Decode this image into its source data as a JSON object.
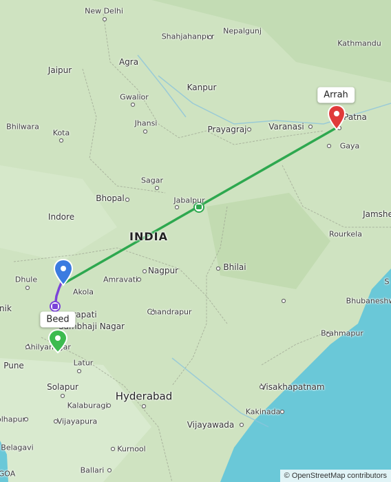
{
  "map": {
    "country_label": "INDIA",
    "places": {
      "new_delhi": "New Delhi",
      "nepalgunj": "Nepalgunj",
      "shahjahanpur": "Shahjahanpur",
      "kathmandu": "Kathmandu",
      "jaipur": "Jaipur",
      "agra": "Agra",
      "kanpur": "Kanpur",
      "gwalior": "Gwalior",
      "bhilwara": "Bhilwara",
      "jhansi": "Jhansi",
      "prayagraj": "Prayagraj",
      "varanasi": "Varanasi",
      "patna": "Patna",
      "kota": "Kota",
      "gaya": "Gaya",
      "sagar": "Sagar",
      "bhopal": "Bhopal",
      "jabalpur": "Jabalpur",
      "jamshedpur": "Jamshe",
      "indore": "Indore",
      "rourkela": "Rourkela",
      "bhilai": "Bhilai",
      "nagpur": "Nagpur",
      "dhule": "Dhule",
      "amravati": "Amravati",
      "akola": "Akola",
      "sambalpur": "S",
      "nashik": "nik",
      "bhubaneswar": "Bhubaneshw",
      "sambhajinagar_1": "rapati",
      "sambhajinagar_2": "Sambhaji Nagar",
      "chandrapur": "Chandrapur",
      "brahmapur": "Brahmapur",
      "ahilyanagar": "Ahilyanagar",
      "pune": "Pune",
      "latur": "Latur",
      "visakhapatnam": "Visakhapatnam",
      "solapur": "Solapur",
      "hyderabad": "Hyderabad",
      "kalaburagi": "Kalaburagi",
      "kakinada": "Kakinada",
      "kolhapur": "olhapur",
      "vijayapura": "Vijayapura",
      "vijayawada": "Vijayawada",
      "belagavi": "Belagavi",
      "kurnool": "Kurnool",
      "goa": "GOA",
      "ballari": "Ballari"
    },
    "markers": {
      "origin_label": "Beed",
      "destination_label": "Arrah"
    },
    "colors": {
      "route_train": "#2ea84f",
      "route_drive": "#7b44d9",
      "origin_pin": "#3b7be0",
      "start_pin": "#3dbb4f",
      "destination_pin": "#e03a3a",
      "water": "#6ac8d8"
    },
    "attribution": "© OpenStreetMap contributors"
  }
}
